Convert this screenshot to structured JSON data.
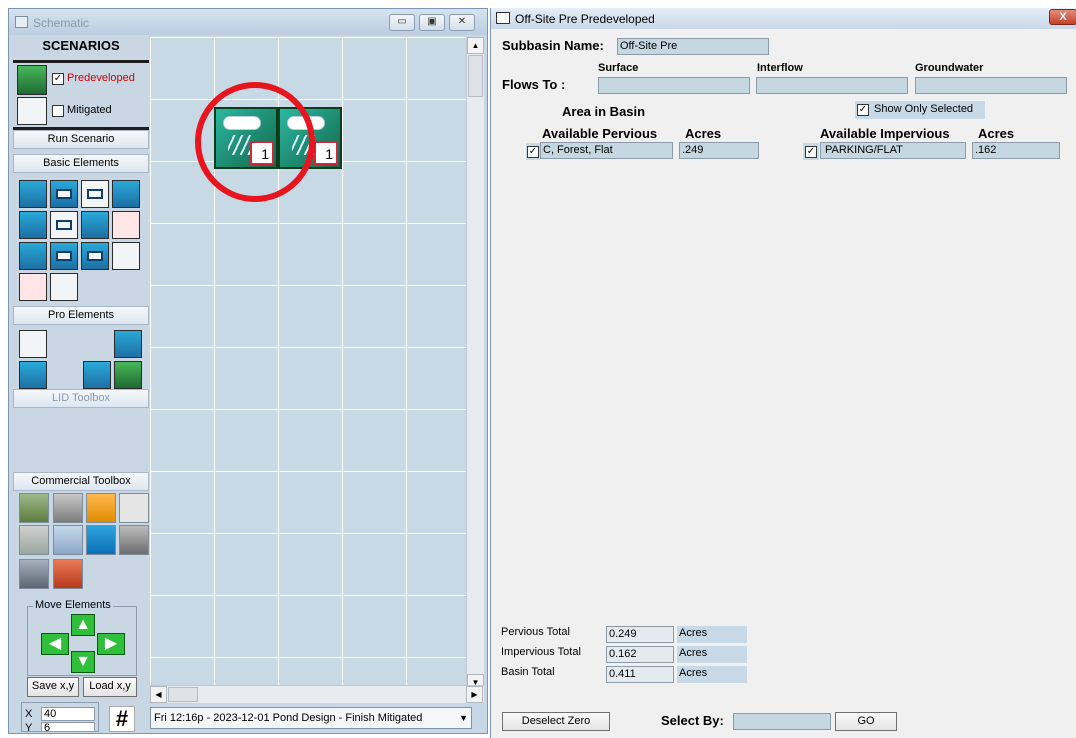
{
  "schematic": {
    "title": "Schematic",
    "scenarios_header": "SCENARIOS",
    "scenarios": [
      {
        "label": "Predeveloped",
        "checked": true,
        "color": "#d40000"
      },
      {
        "label": "Mitigated",
        "checked": false,
        "color": "#000000"
      }
    ],
    "run_scenario": "Run Scenario",
    "basic_elements": "Basic Elements",
    "pro_elements": "Pro Elements",
    "lid_toolbox": "LID Toolbox",
    "commercial_toolbox": "Commercial Toolbox",
    "move_elements": "Move Elements",
    "save_xy": "Save x,y",
    "load_xy": "Load x,y",
    "coord_x_label": "X",
    "coord_x_value": "40",
    "coord_y_label": "Y",
    "coord_y_value": "6",
    "grid_symbol": "#",
    "status_text": "Fri 12:16p - 2023-12-01 Pond Design - Finish Mitigated",
    "elements": [
      {
        "icon": "basin-icon",
        "badge": "1"
      },
      {
        "icon": "basin-icon",
        "badge": "1"
      }
    ]
  },
  "detail": {
    "title": "Off-Site Pre Predeveloped",
    "close_symbol": "X",
    "subbasin_label": "Subbasin Name:",
    "subbasin_value": "Off-Site Pre",
    "flows_to_label": "Flows To :",
    "flow_columns": [
      "Surface",
      "Interflow",
      "Groundwater"
    ],
    "flow_values": [
      "",
      "",
      ""
    ],
    "area_in_basin": "Area in Basin",
    "show_only_selected": "Show Only Selected",
    "show_only_selected_checked": true,
    "pervious_header": "Available Pervious",
    "impervious_header": "Available Impervious",
    "acres_header": "Acres",
    "pervious_rows": [
      {
        "checked": true,
        "name": "C, Forest, Flat",
        "acres": ".249"
      }
    ],
    "impervious_rows": [
      {
        "checked": true,
        "name": "PARKING/FLAT",
        "acres": ".162"
      }
    ],
    "totals": [
      {
        "label": "Pervious Total",
        "value": "0.249",
        "unit": "Acres"
      },
      {
        "label": "Impervious Total",
        "value": "0.162",
        "unit": "Acres"
      },
      {
        "label": "Basin Total",
        "value": "0.411",
        "unit": "Acres"
      }
    ],
    "deselect_zero": "Deselect Zero",
    "select_by_label": "Select By:",
    "select_by_value": "",
    "go_button": "GO"
  }
}
